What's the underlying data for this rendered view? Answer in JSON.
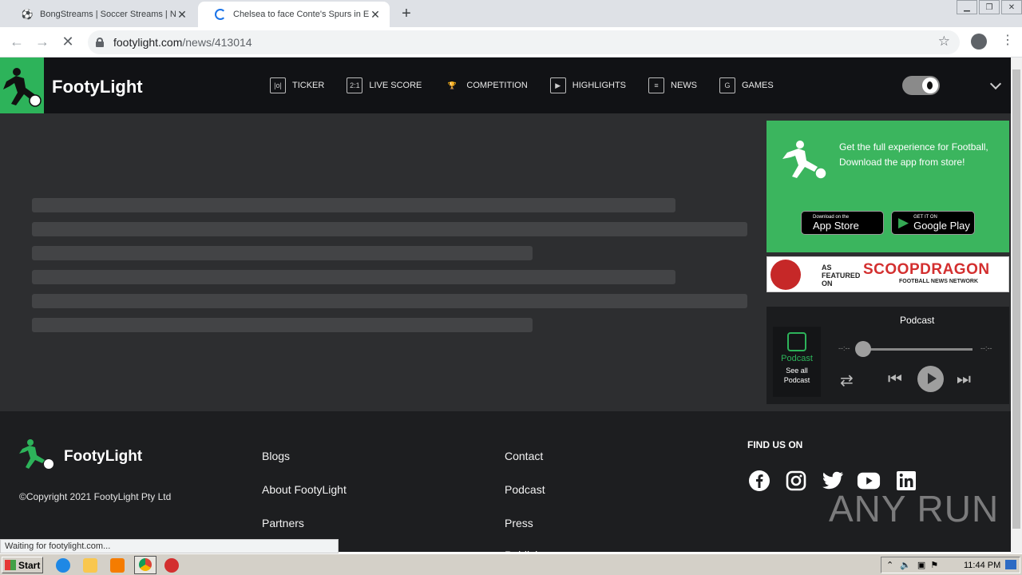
{
  "browser": {
    "tabs": [
      {
        "title": "BongStreams | Soccer Streams | NBA",
        "active": false
      },
      {
        "title": "Chelsea to face Conte's Spurs in EFL",
        "active": true
      }
    ],
    "url_host": "footylight.com",
    "url_path": "/news/413014",
    "status_text": "Waiting for footylight.com..."
  },
  "site": {
    "brand": "FootyLight",
    "nav": [
      {
        "label": "TICKER",
        "icon": "ticker-icon",
        "glyph": "|o|"
      },
      {
        "label": "LIVE SCORE",
        "icon": "live-score-icon",
        "glyph": "2:1"
      },
      {
        "label": "COMPETITION",
        "icon": "trophy-icon",
        "glyph": "🏆"
      },
      {
        "label": "HIGHLIGHTS",
        "icon": "play-icon",
        "glyph": "▶"
      },
      {
        "label": "NEWS",
        "icon": "news-icon",
        "glyph": "≡"
      },
      {
        "label": "GAMES",
        "icon": "games-icon",
        "glyph": "G"
      }
    ]
  },
  "promo": {
    "text": "Get the full experience for Football, Download the app from store!",
    "app_store_small": "Download on the",
    "app_store_big": "App Store",
    "google_small": "GET IT ON",
    "google_big": "Google Play"
  },
  "banner": {
    "featured_line1": "AS",
    "featured_line2": "FEATURED",
    "featured_line3": "ON",
    "brand": "SCOOPDRAGON",
    "sub": "FOOTBALL NEWS NETWORK"
  },
  "podcast": {
    "title": "Podcast",
    "side_label": "Podcast",
    "see_all": "See all Podcast",
    "time_left": "--:--",
    "time_right": "--:--"
  },
  "footer": {
    "brand": "FootyLight",
    "copyright": "©Copyright 2021 FootyLight Pty Ltd",
    "col1": [
      "Blogs",
      "About FootyLight",
      "Partners"
    ],
    "col2": [
      "Contact",
      "Podcast",
      "Press",
      "Publish"
    ],
    "find_us": "FIND US ON",
    "social": [
      "facebook-icon",
      "instagram-icon",
      "twitter-icon",
      "youtube-icon",
      "linkedin-icon"
    ]
  },
  "watermark": "ANY RUN",
  "taskbar": {
    "start": "Start",
    "clock": "11:44 PM"
  },
  "colors": {
    "brand_green": "#2db35a",
    "header_bg": "#111215",
    "main_bg": "#2d2e30"
  }
}
